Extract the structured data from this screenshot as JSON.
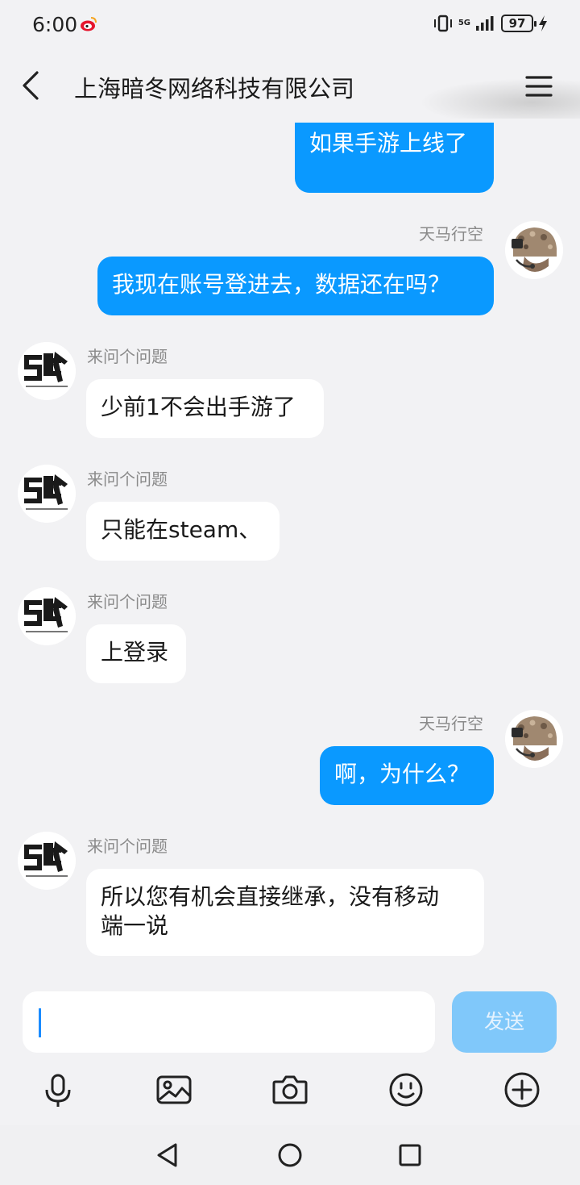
{
  "status_bar": {
    "time": "6:00",
    "network": "5G",
    "battery": "97",
    "icons": [
      "weibo-icon",
      "vibrate-icon",
      "signal-icon",
      "charging-icon"
    ]
  },
  "header": {
    "title": "上海暗冬网络科技有限公司",
    "icons": [
      "back-arrow-icon",
      "menu-icon"
    ]
  },
  "messages": [
    {
      "direction": "out",
      "text": "如果手游上线了",
      "partial": true
    },
    {
      "direction": "out",
      "sender": "天马行空",
      "text": "我现在账号登进去，数据还在吗？"
    },
    {
      "direction": "in",
      "sender": "来问个问题",
      "text": "少前1不会出手游了"
    },
    {
      "direction": "in",
      "sender": "来问个问题",
      "text": "只能在steam、"
    },
    {
      "direction": "in",
      "sender": "来问个问题",
      "text": "上登录"
    },
    {
      "direction": "out",
      "sender": "天马行空",
      "text": "啊，为什么？"
    },
    {
      "direction": "in",
      "sender": "来问个问题",
      "text_line1": "所以您有机会直接继承，没有移动",
      "text_line2": "端一说"
    }
  ],
  "input": {
    "value": "",
    "send_label": "发送"
  },
  "toolbar": {
    "icons": [
      "microphone-icon",
      "image-icon",
      "camera-icon",
      "emoji-icon",
      "plus-icon"
    ]
  },
  "nav_bar": {
    "icons": [
      "back-triangle-icon",
      "home-circle-icon",
      "recents-square-icon"
    ]
  },
  "colors": {
    "outgoing_bubble": "#0a99ff",
    "incoming_bubble": "#ffffff",
    "background": "#f2f2f4",
    "send_button": "#80c8fa",
    "caret": "#1a8cff"
  }
}
